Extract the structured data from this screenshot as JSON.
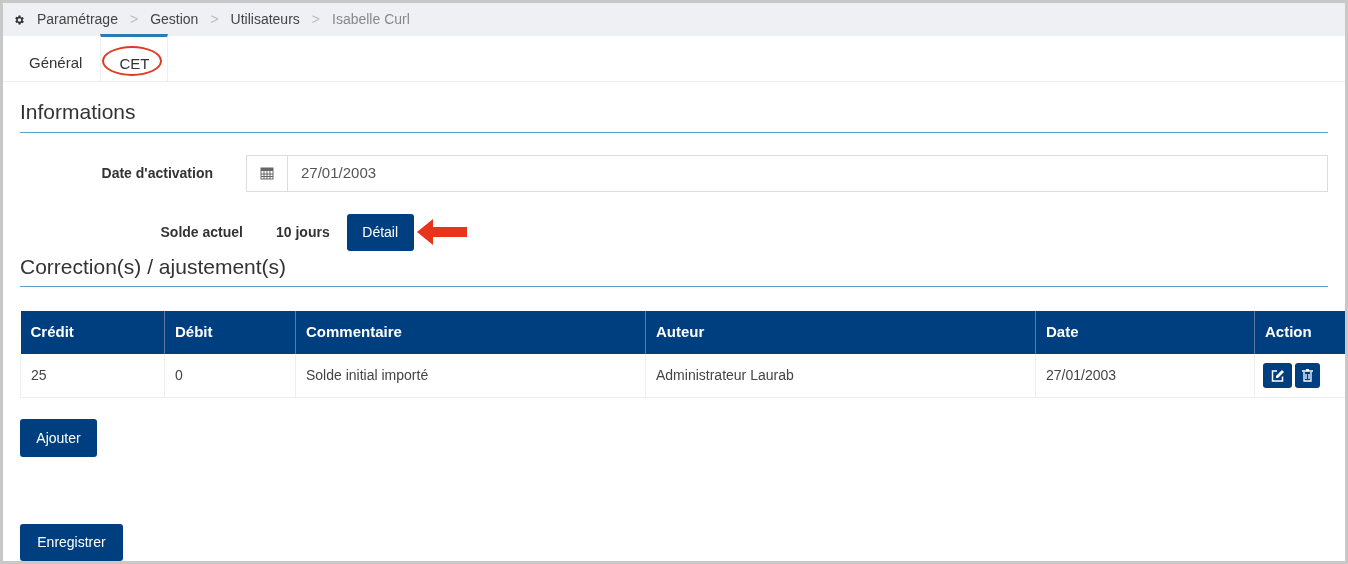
{
  "breadcrumb": [
    {
      "label": "Paramétrage",
      "kind": "link"
    },
    {
      "label": "Gestion",
      "kind": "link"
    },
    {
      "label": "Utilisateurs",
      "kind": "link"
    },
    {
      "label": "Isabelle Curl",
      "kind": "current"
    }
  ],
  "breadcrumb_separator": ">",
  "tabs": [
    {
      "label": "Général",
      "selected": false
    },
    {
      "label": "CET",
      "selected": true,
      "circled": true
    }
  ],
  "informations": {
    "title": "Informations",
    "date_label": "Date d'activation",
    "date_value": "27/01/2003",
    "balance_label": "Solde actuel",
    "balance_value": "10 jours",
    "detail_button": "Détail"
  },
  "corrections": {
    "title": "Correction(s) / ajustement(s)",
    "columns": [
      "Crédit",
      "Débit",
      "Commentaire",
      "Auteur",
      "Date",
      "Action"
    ],
    "rows": [
      {
        "cells": [
          "25",
          "0",
          "Solde initial importé",
          "Administrateur Laurab",
          "27/01/2003"
        ]
      }
    ],
    "add_button": "Ajouter"
  },
  "save_button": "Enregistrer"
}
